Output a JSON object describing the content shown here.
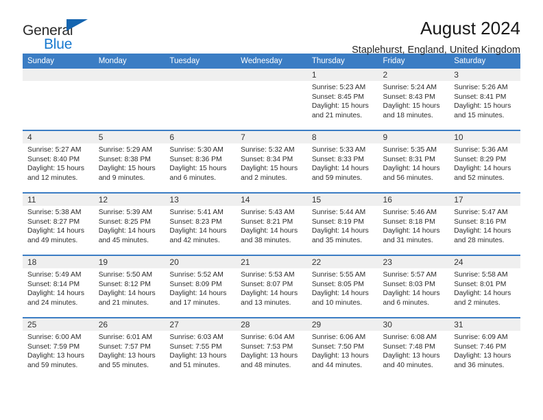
{
  "brand": {
    "line1": "General",
    "line2": "Blue",
    "triangle_color": "#1565b0",
    "blue_text_color": "#1879cf"
  },
  "header": {
    "title": "August 2024",
    "location": "Staplehurst, England, United Kingdom"
  },
  "theme": {
    "header_row_bg": "#3b7dc4",
    "header_row_text": "#ffffff",
    "daynum_bg": "#efefef",
    "cell_bg": "#ffffff",
    "row_divider": "#3b7dc4"
  },
  "weekday_headers": [
    "Sunday",
    "Monday",
    "Tuesday",
    "Wednesday",
    "Thursday",
    "Friday",
    "Saturday"
  ],
  "weeks": [
    [
      {
        "day": "",
        "empty": true,
        "sunrise": "",
        "sunset": "",
        "daylight_line1": "",
        "daylight_line2": ""
      },
      {
        "day": "",
        "empty": true,
        "sunrise": "",
        "sunset": "",
        "daylight_line1": "",
        "daylight_line2": ""
      },
      {
        "day": "",
        "empty": true,
        "sunrise": "",
        "sunset": "",
        "daylight_line1": "",
        "daylight_line2": ""
      },
      {
        "day": "",
        "empty": true,
        "sunrise": "",
        "sunset": "",
        "daylight_line1": "",
        "daylight_line2": ""
      },
      {
        "day": "1",
        "sunrise": "Sunrise: 5:23 AM",
        "sunset": "Sunset: 8:45 PM",
        "daylight_line1": "Daylight: 15 hours",
        "daylight_line2": "and 21 minutes."
      },
      {
        "day": "2",
        "sunrise": "Sunrise: 5:24 AM",
        "sunset": "Sunset: 8:43 PM",
        "daylight_line1": "Daylight: 15 hours",
        "daylight_line2": "and 18 minutes."
      },
      {
        "day": "3",
        "sunrise": "Sunrise: 5:26 AM",
        "sunset": "Sunset: 8:41 PM",
        "daylight_line1": "Daylight: 15 hours",
        "daylight_line2": "and 15 minutes."
      }
    ],
    [
      {
        "day": "4",
        "sunrise": "Sunrise: 5:27 AM",
        "sunset": "Sunset: 8:40 PM",
        "daylight_line1": "Daylight: 15 hours",
        "daylight_line2": "and 12 minutes."
      },
      {
        "day": "5",
        "sunrise": "Sunrise: 5:29 AM",
        "sunset": "Sunset: 8:38 PM",
        "daylight_line1": "Daylight: 15 hours",
        "daylight_line2": "and 9 minutes."
      },
      {
        "day": "6",
        "sunrise": "Sunrise: 5:30 AM",
        "sunset": "Sunset: 8:36 PM",
        "daylight_line1": "Daylight: 15 hours",
        "daylight_line2": "and 6 minutes."
      },
      {
        "day": "7",
        "sunrise": "Sunrise: 5:32 AM",
        "sunset": "Sunset: 8:34 PM",
        "daylight_line1": "Daylight: 15 hours",
        "daylight_line2": "and 2 minutes."
      },
      {
        "day": "8",
        "sunrise": "Sunrise: 5:33 AM",
        "sunset": "Sunset: 8:33 PM",
        "daylight_line1": "Daylight: 14 hours",
        "daylight_line2": "and 59 minutes."
      },
      {
        "day": "9",
        "sunrise": "Sunrise: 5:35 AM",
        "sunset": "Sunset: 8:31 PM",
        "daylight_line1": "Daylight: 14 hours",
        "daylight_line2": "and 56 minutes."
      },
      {
        "day": "10",
        "sunrise": "Sunrise: 5:36 AM",
        "sunset": "Sunset: 8:29 PM",
        "daylight_line1": "Daylight: 14 hours",
        "daylight_line2": "and 52 minutes."
      }
    ],
    [
      {
        "day": "11",
        "sunrise": "Sunrise: 5:38 AM",
        "sunset": "Sunset: 8:27 PM",
        "daylight_line1": "Daylight: 14 hours",
        "daylight_line2": "and 49 minutes."
      },
      {
        "day": "12",
        "sunrise": "Sunrise: 5:39 AM",
        "sunset": "Sunset: 8:25 PM",
        "daylight_line1": "Daylight: 14 hours",
        "daylight_line2": "and 45 minutes."
      },
      {
        "day": "13",
        "sunrise": "Sunrise: 5:41 AM",
        "sunset": "Sunset: 8:23 PM",
        "daylight_line1": "Daylight: 14 hours",
        "daylight_line2": "and 42 minutes."
      },
      {
        "day": "14",
        "sunrise": "Sunrise: 5:43 AM",
        "sunset": "Sunset: 8:21 PM",
        "daylight_line1": "Daylight: 14 hours",
        "daylight_line2": "and 38 minutes."
      },
      {
        "day": "15",
        "sunrise": "Sunrise: 5:44 AM",
        "sunset": "Sunset: 8:19 PM",
        "daylight_line1": "Daylight: 14 hours",
        "daylight_line2": "and 35 minutes."
      },
      {
        "day": "16",
        "sunrise": "Sunrise: 5:46 AM",
        "sunset": "Sunset: 8:18 PM",
        "daylight_line1": "Daylight: 14 hours",
        "daylight_line2": "and 31 minutes."
      },
      {
        "day": "17",
        "sunrise": "Sunrise: 5:47 AM",
        "sunset": "Sunset: 8:16 PM",
        "daylight_line1": "Daylight: 14 hours",
        "daylight_line2": "and 28 minutes."
      }
    ],
    [
      {
        "day": "18",
        "sunrise": "Sunrise: 5:49 AM",
        "sunset": "Sunset: 8:14 PM",
        "daylight_line1": "Daylight: 14 hours",
        "daylight_line2": "and 24 minutes."
      },
      {
        "day": "19",
        "sunrise": "Sunrise: 5:50 AM",
        "sunset": "Sunset: 8:12 PM",
        "daylight_line1": "Daylight: 14 hours",
        "daylight_line2": "and 21 minutes."
      },
      {
        "day": "20",
        "sunrise": "Sunrise: 5:52 AM",
        "sunset": "Sunset: 8:09 PM",
        "daylight_line1": "Daylight: 14 hours",
        "daylight_line2": "and 17 minutes."
      },
      {
        "day": "21",
        "sunrise": "Sunrise: 5:53 AM",
        "sunset": "Sunset: 8:07 PM",
        "daylight_line1": "Daylight: 14 hours",
        "daylight_line2": "and 13 minutes."
      },
      {
        "day": "22",
        "sunrise": "Sunrise: 5:55 AM",
        "sunset": "Sunset: 8:05 PM",
        "daylight_line1": "Daylight: 14 hours",
        "daylight_line2": "and 10 minutes."
      },
      {
        "day": "23",
        "sunrise": "Sunrise: 5:57 AM",
        "sunset": "Sunset: 8:03 PM",
        "daylight_line1": "Daylight: 14 hours",
        "daylight_line2": "and 6 minutes."
      },
      {
        "day": "24",
        "sunrise": "Sunrise: 5:58 AM",
        "sunset": "Sunset: 8:01 PM",
        "daylight_line1": "Daylight: 14 hours",
        "daylight_line2": "and 2 minutes."
      }
    ],
    [
      {
        "day": "25",
        "sunrise": "Sunrise: 6:00 AM",
        "sunset": "Sunset: 7:59 PM",
        "daylight_line1": "Daylight: 13 hours",
        "daylight_line2": "and 59 minutes."
      },
      {
        "day": "26",
        "sunrise": "Sunrise: 6:01 AM",
        "sunset": "Sunset: 7:57 PM",
        "daylight_line1": "Daylight: 13 hours",
        "daylight_line2": "and 55 minutes."
      },
      {
        "day": "27",
        "sunrise": "Sunrise: 6:03 AM",
        "sunset": "Sunset: 7:55 PM",
        "daylight_line1": "Daylight: 13 hours",
        "daylight_line2": "and 51 minutes."
      },
      {
        "day": "28",
        "sunrise": "Sunrise: 6:04 AM",
        "sunset": "Sunset: 7:53 PM",
        "daylight_line1": "Daylight: 13 hours",
        "daylight_line2": "and 48 minutes."
      },
      {
        "day": "29",
        "sunrise": "Sunrise: 6:06 AM",
        "sunset": "Sunset: 7:50 PM",
        "daylight_line1": "Daylight: 13 hours",
        "daylight_line2": "and 44 minutes."
      },
      {
        "day": "30",
        "sunrise": "Sunrise: 6:08 AM",
        "sunset": "Sunset: 7:48 PM",
        "daylight_line1": "Daylight: 13 hours",
        "daylight_line2": "and 40 minutes."
      },
      {
        "day": "31",
        "sunrise": "Sunrise: 6:09 AM",
        "sunset": "Sunset: 7:46 PM",
        "daylight_line1": "Daylight: 13 hours",
        "daylight_line2": "and 36 minutes."
      }
    ]
  ]
}
